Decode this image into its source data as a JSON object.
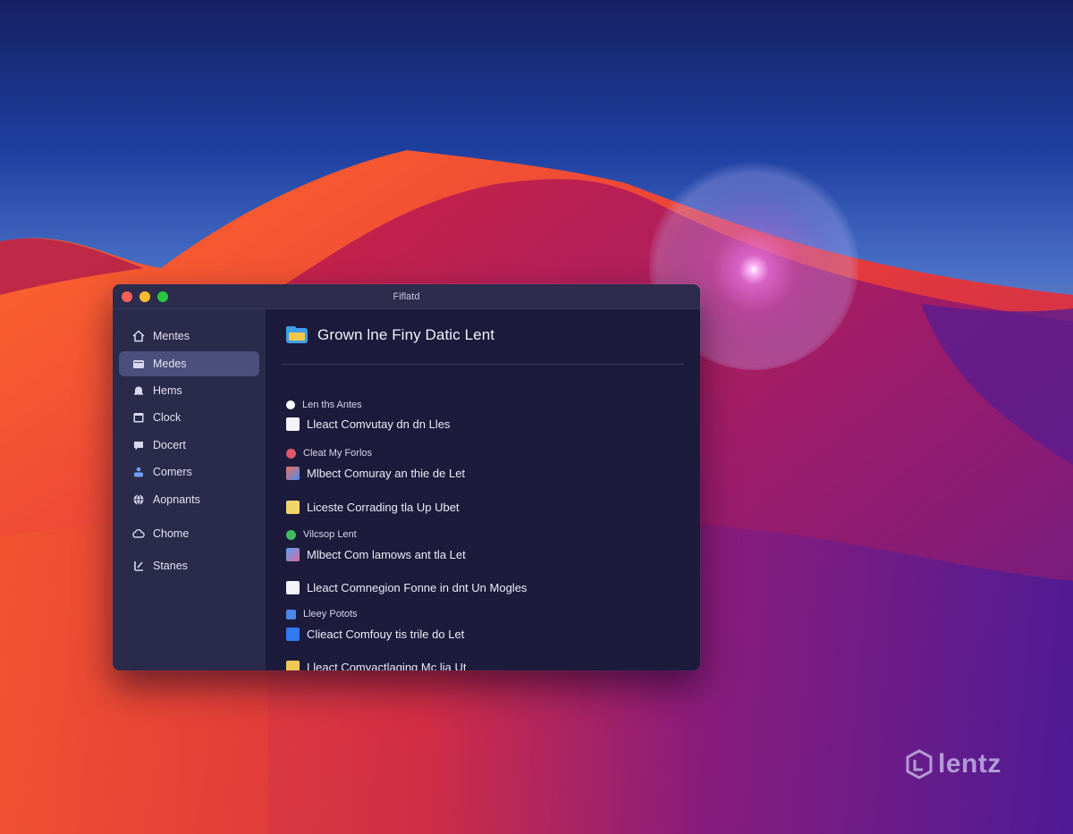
{
  "window": {
    "title": "Fiflatd"
  },
  "sidebar": {
    "items": [
      {
        "label": "Mentes",
        "icon": "house-icon"
      },
      {
        "label": "Medes",
        "icon": "folder-icon",
        "active": true
      },
      {
        "label": "Hems",
        "icon": "bell-icon"
      },
      {
        "label": "Clock",
        "icon": "calendar-icon"
      },
      {
        "label": "Docert",
        "icon": "chat-bubble-icon"
      },
      {
        "label": "Comers",
        "icon": "people-icon"
      },
      {
        "label": "Aopnants",
        "icon": "globe-icon"
      },
      {
        "label": "Chome",
        "icon": "cloud-icon"
      },
      {
        "label": "Stanes",
        "icon": "tools-icon"
      }
    ]
  },
  "main": {
    "title": "Grown lne Finy Datic Lent",
    "rows": [
      {
        "kind": "small",
        "label": "Len ths Antes",
        "icon": "info-icon",
        "color": "#ffffff"
      },
      {
        "kind": "big",
        "label": "Lleact Comvutay dn dn Lles",
        "icon": "document-icon",
        "color": "#f4f4f8"
      },
      {
        "kind": "small",
        "label": "Cleat My Forlos",
        "icon": "record-icon",
        "color": "#e2566a"
      },
      {
        "kind": "big",
        "label": "Mlbect Comuray an thie de Let",
        "icon": "photos-icon",
        "color": "#4a8df0"
      },
      {
        "kind": "big",
        "label": "Liceste Corrading tla Up Ubet",
        "icon": "note-icon",
        "color": "#f3d46a"
      },
      {
        "kind": "small",
        "label": "Vilcsop Lent",
        "icon": "check-icon",
        "color": "#3fbf5c"
      },
      {
        "kind": "big",
        "label": "Mlbect Com lamows ant tla Let",
        "icon": "finder-icon",
        "color": "#d86b9e"
      },
      {
        "kind": "big",
        "label": "Lleact Comnegion Fonne in dnt Un Mogles",
        "icon": "document-icon",
        "color": "#f4f4f8"
      },
      {
        "kind": "small",
        "label": "Lleey Potots",
        "icon": "tag-icon",
        "color": "#4b87e8"
      },
      {
        "kind": "big",
        "label": "Clieact Comfouy tis trile do Let",
        "icon": "app-store-icon",
        "color": "#2f7bf0"
      },
      {
        "kind": "big",
        "label": "Lleact Comvactlaging Mc lia Ut",
        "icon": "note-icon",
        "color": "#f0c85a"
      }
    ]
  },
  "watermark": {
    "text": "lentz"
  }
}
